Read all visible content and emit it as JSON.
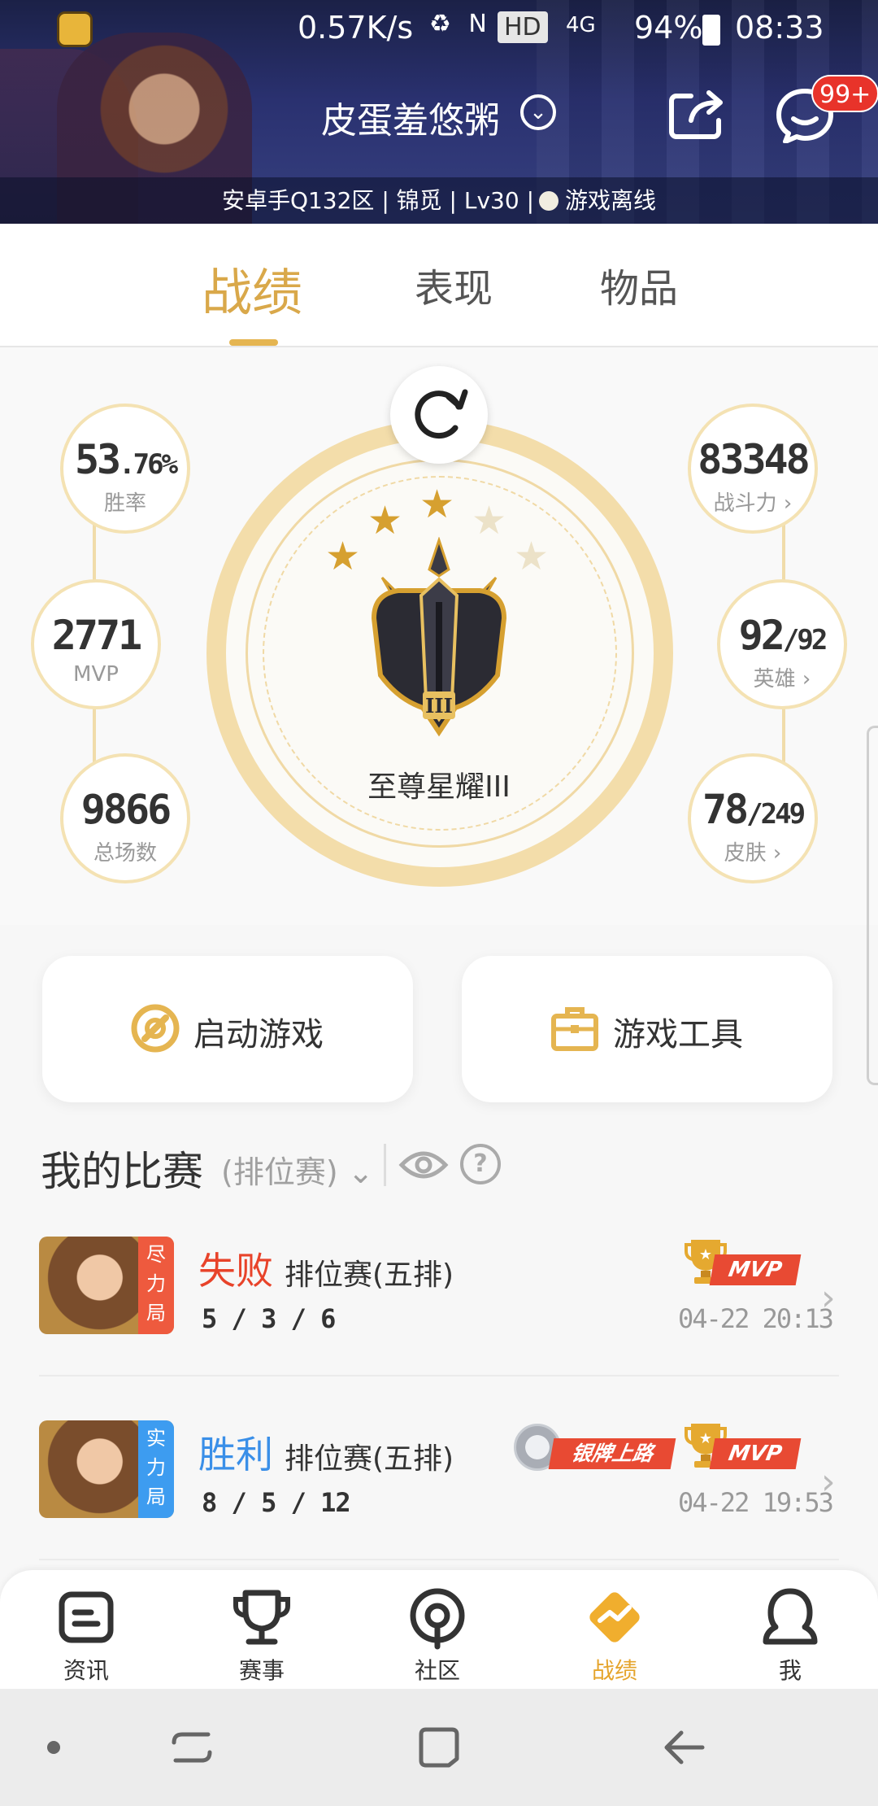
{
  "status_bar": {
    "speed": "0.57K/s",
    "icons": "♻ N",
    "hd": "HD",
    "network": "4G",
    "battery": "94%",
    "time": "08:33"
  },
  "header": {
    "player_name": "皮蛋羞悠粥",
    "chevron_glyph": "⌄",
    "message_badge": "99+",
    "info": "安卓手Q132区 | 锦觅 | Lv30 |",
    "online_status": "游戏离线"
  },
  "tabs": [
    {
      "label": "战绩",
      "active": true
    },
    {
      "label": "表现",
      "active": false
    },
    {
      "label": "物品",
      "active": false
    }
  ],
  "stats": {
    "win_rate": {
      "value_main": "53",
      "value_small": ".76%",
      "label": "胜率"
    },
    "mvp": {
      "value": "2771",
      "label": "MVP"
    },
    "total_games": {
      "value": "9866",
      "label": "总场数"
    },
    "power": {
      "value": "83348",
      "label": "战斗力 ›"
    },
    "heroes": {
      "value_main": "92",
      "value_small": "/92",
      "label": "英雄 ›"
    },
    "skins": {
      "value_main": "78",
      "value_small": "/249",
      "label": "皮肤 ›"
    }
  },
  "rank": {
    "name": "至尊星耀III",
    "stars_earned": 3,
    "stars_total": 5,
    "emblem_numeral": "III"
  },
  "actions": {
    "launch_game": "启动游戏",
    "game_tools": "游戏工具"
  },
  "matches_section": {
    "title": "我的比赛",
    "filter": "(排位赛)",
    "filter_chevron": "⌄",
    "help": "?"
  },
  "matches": [
    {
      "mode_tag": "尽力局",
      "mode_color": "#ee5a3e",
      "result": "失败",
      "result_color": "#e8432a",
      "type": "排位赛(五排)",
      "kda": "5 / 3 / 6",
      "time": "04-22 20:13",
      "mvp": "MVP",
      "extra_badge": ""
    },
    {
      "mode_tag": "实力局",
      "mode_color": "#3d9cf0",
      "result": "胜利",
      "result_color": "#3a8fe8",
      "type": "排位赛(五排)",
      "kda": "8 / 5 / 12",
      "time": "04-22 19:53",
      "mvp": "MVP",
      "extra_badge": "银牌上路"
    }
  ],
  "bottom_nav": [
    {
      "label": "资讯",
      "icon": "news-icon"
    },
    {
      "label": "赛事",
      "icon": "trophy-icon"
    },
    {
      "label": "社区",
      "icon": "community-icon"
    },
    {
      "label": "战绩",
      "icon": "record-icon",
      "active": true
    },
    {
      "label": "我",
      "icon": "profile-icon"
    }
  ],
  "colors": {
    "accent_gold": "#d9a84a",
    "loss_red": "#e8432a",
    "win_blue": "#3a8fe8",
    "badge_red": "#e8332a"
  }
}
